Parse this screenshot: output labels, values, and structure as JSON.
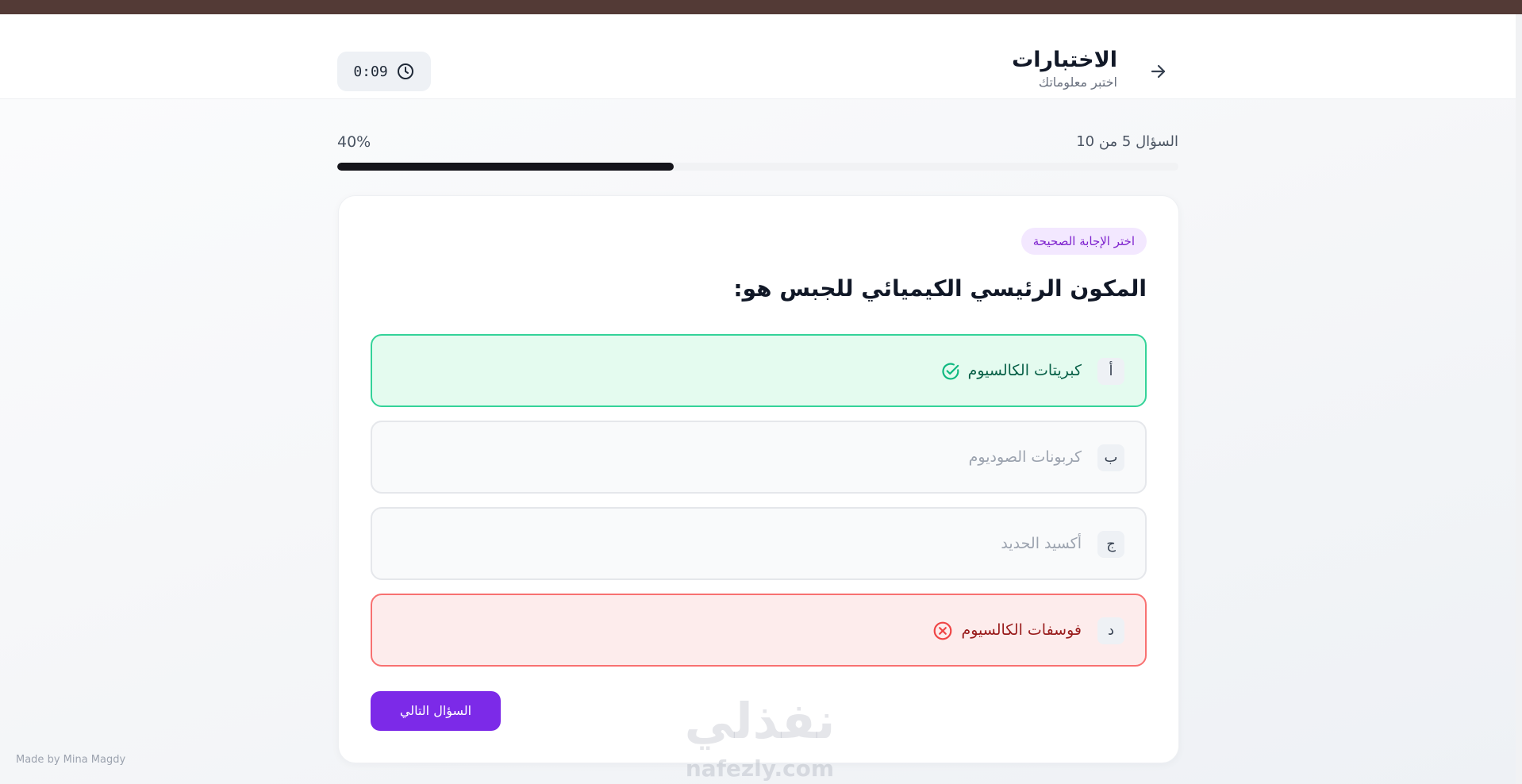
{
  "header": {
    "title": "الاختبارات",
    "subtitle": "اختبر معلوماتك",
    "timer": "0:09",
    "back_icon": "arrow-right-icon",
    "timer_icon": "clock-icon"
  },
  "progress": {
    "counter_label": "السؤال 5 من 10",
    "percent_label": "40%",
    "fraction": 0.4
  },
  "question": {
    "badge": "اختر الإجابة الصحيحة",
    "text": "المكون الرئيسي الكيميائي للجبس هو:",
    "options": [
      {
        "letter": "أ",
        "text": "كبريتات الكالسيوم",
        "state": "correct",
        "icon": "check-circle-icon"
      },
      {
        "letter": "ب",
        "text": "كربونات الصوديوم",
        "state": "neutral"
      },
      {
        "letter": "ج",
        "text": "أكسيد الحديد",
        "state": "neutral"
      },
      {
        "letter": "د",
        "text": "فوسفات الكالسيوم",
        "state": "wrong",
        "icon": "x-circle-icon"
      }
    ]
  },
  "next_button": "السؤال التالي",
  "footer": {
    "credit": "Made by Mina Magdy"
  },
  "watermark": {
    "arabic": "نفذلي",
    "latin": "nafezly.com"
  },
  "colors": {
    "accent": "#7c2ae8",
    "correct_border": "#34d399",
    "correct_bg": "#e4fbef",
    "wrong_border": "#f87171",
    "wrong_bg": "#fdecec",
    "progress_fill": "#14141a",
    "badge_bg": "#f3e8ff",
    "badge_text": "#7e22ce",
    "top_strip": "#533a36"
  }
}
